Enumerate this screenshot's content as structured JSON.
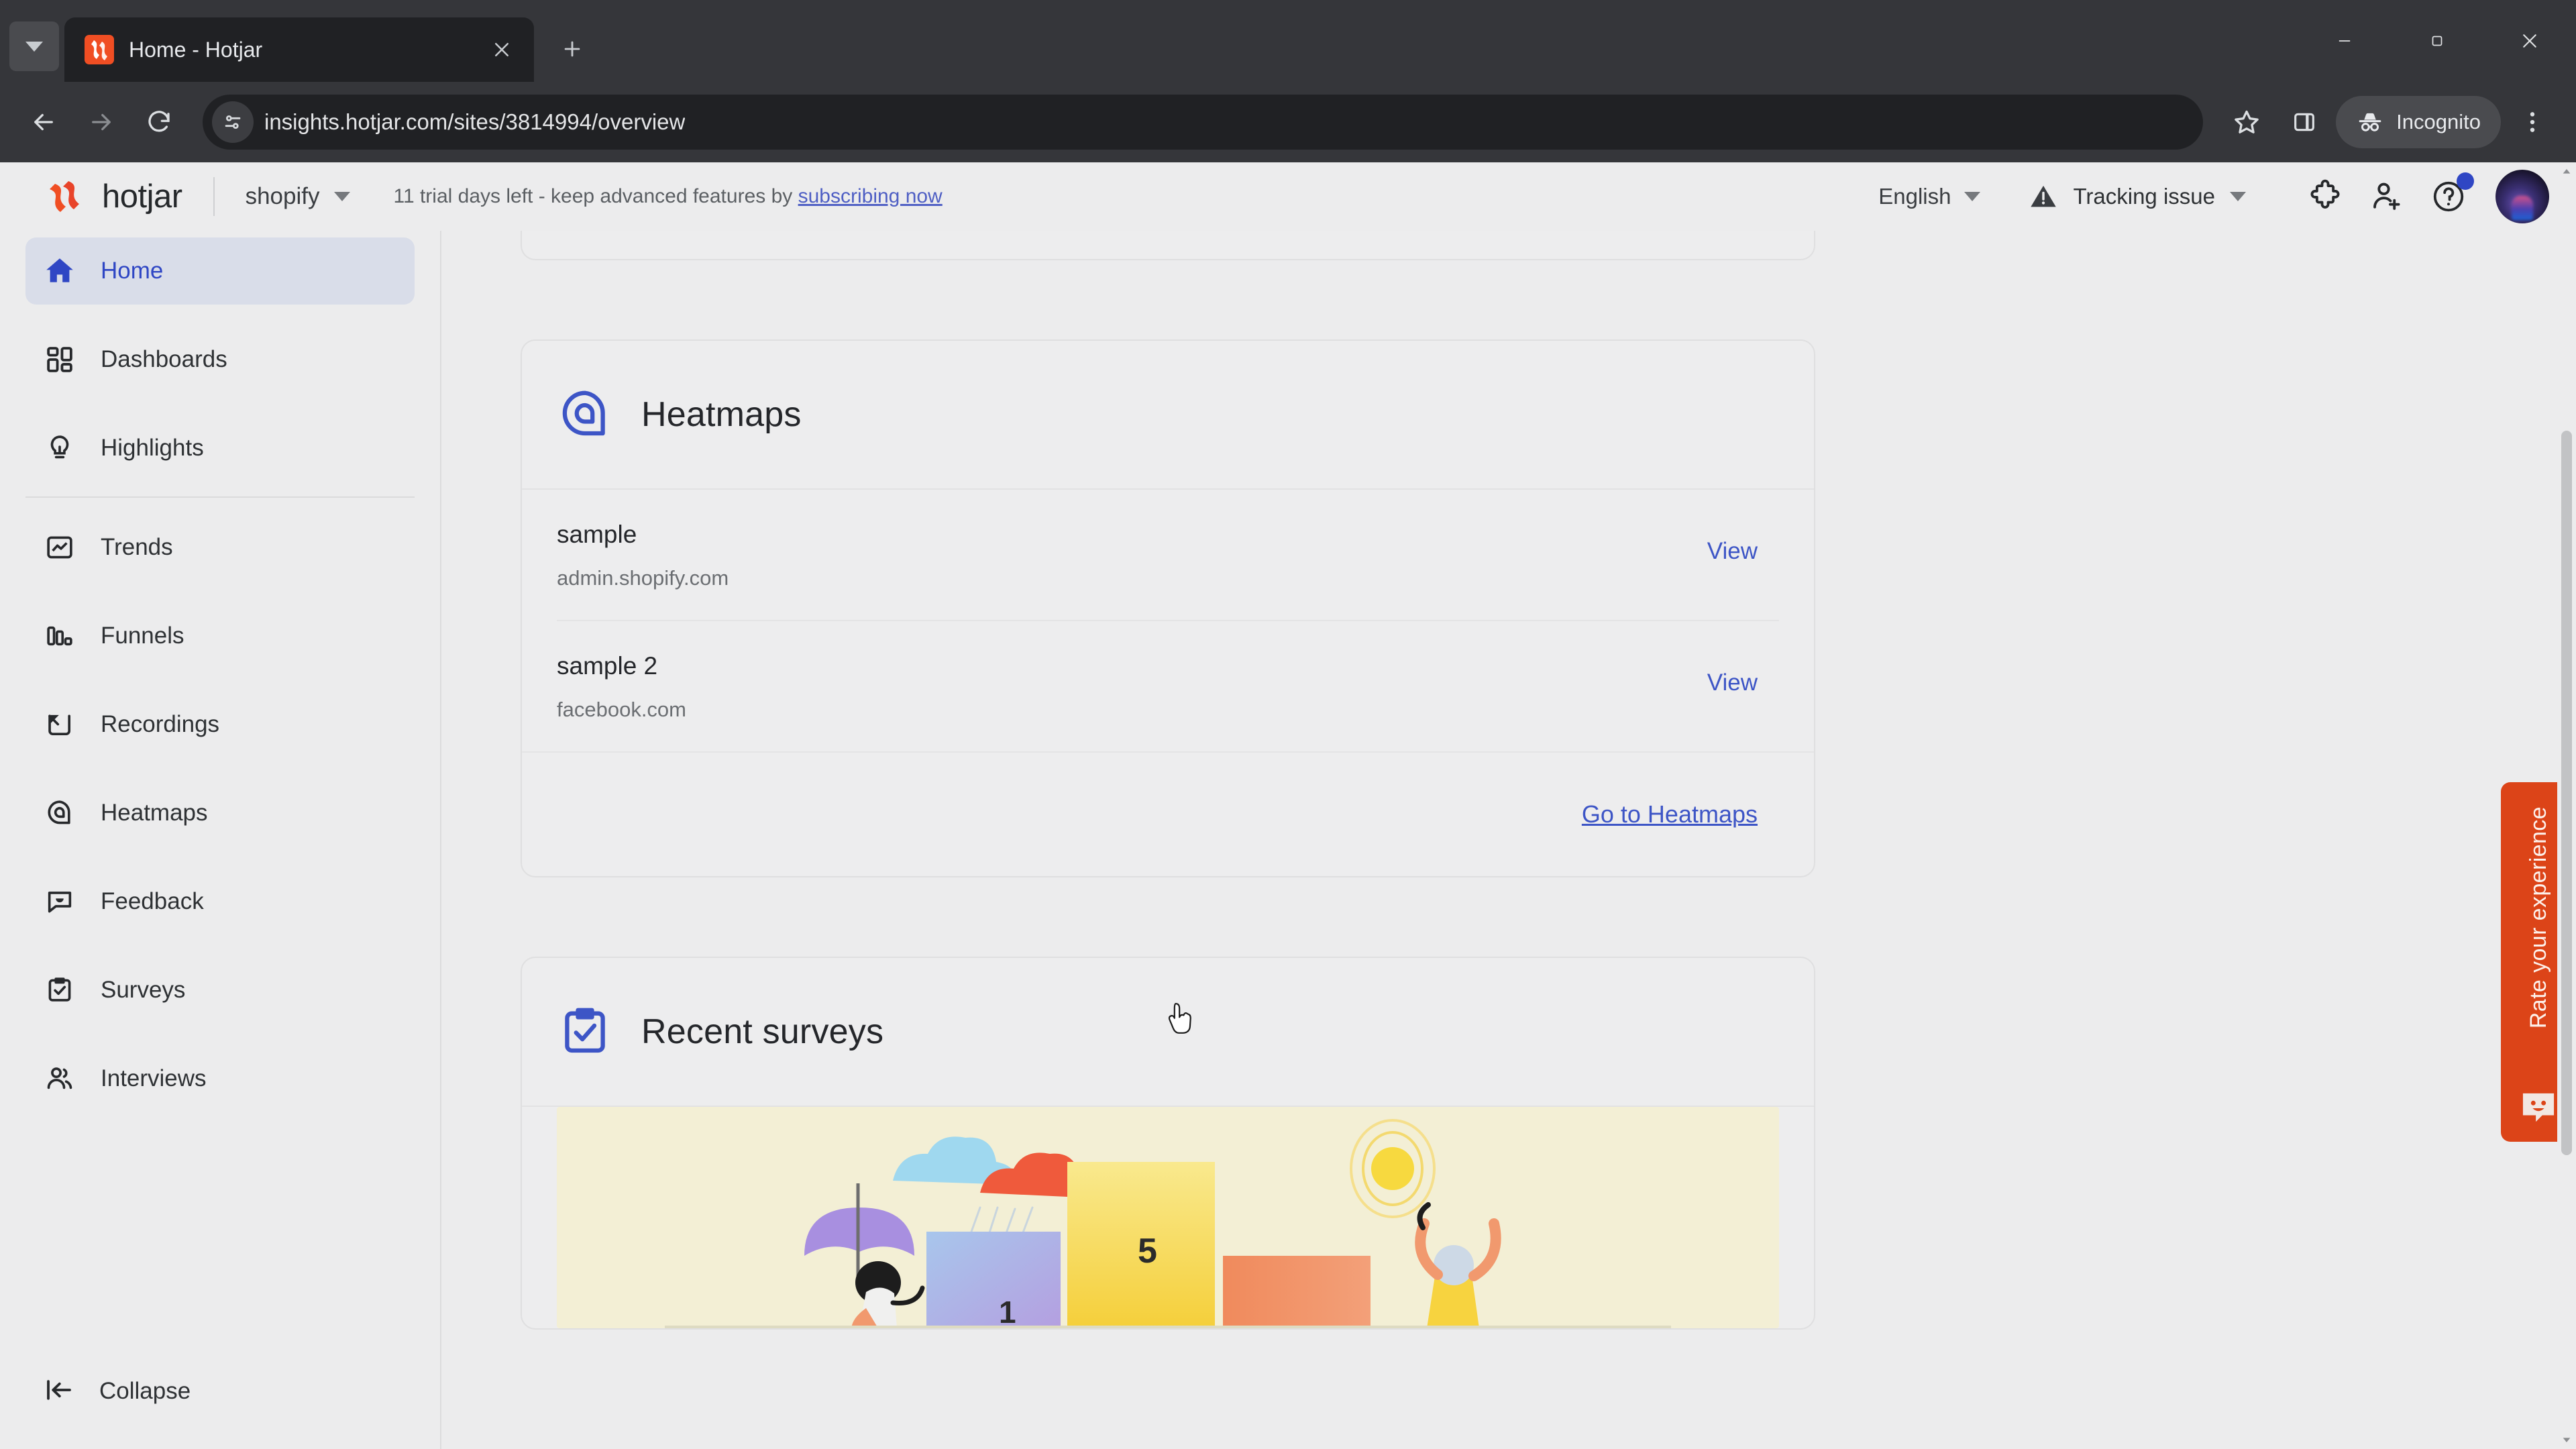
{
  "browser": {
    "tab": {
      "title": "Home - Hotjar",
      "favicon": "hotjar-favicon"
    },
    "new_tab_label": "+",
    "tab_search_icon": "chevron-down-icon",
    "close_icon": "close-icon",
    "nav": {
      "back_icon": "back-arrow-icon",
      "forward_icon": "forward-arrow-icon",
      "reload_icon": "reload-icon"
    },
    "omnibox": {
      "url": "insights.hotjar.com/sites/3814994/overview",
      "site_info_icon": "site-settings-icon",
      "bookmark_icon": "star-icon",
      "side_panel_icon": "side-panel-icon",
      "menu_icon": "three-dot-menu-icon"
    },
    "profile": {
      "label": "Incognito",
      "icon": "incognito-icon"
    },
    "window_controls": {
      "minimize": "minimize-icon",
      "maximize": "maximize-icon",
      "close": "close-icon"
    }
  },
  "app": {
    "brand": {
      "name": "hotjar",
      "logo": "hotjar-logo",
      "color": "#f04e23"
    },
    "site_switcher": {
      "value": "shopify",
      "caret": "chevron-down-icon"
    },
    "trial_banner": {
      "text": "11 trial days left - keep advanced features by ",
      "link_text": "subscribing now"
    },
    "language": {
      "value": "English",
      "caret": "chevron-down-icon"
    },
    "tracking": {
      "label": "Tracking issue",
      "icon": "warning-icon",
      "caret": "chevron-down-icon"
    },
    "header_icons": [
      {
        "name": "integrations-icon",
        "label": "Integrations"
      },
      {
        "name": "invite-user-icon",
        "label": "Invite team member"
      },
      {
        "name": "help-icon",
        "label": "Help",
        "badge": true
      }
    ],
    "avatar": {
      "name": "user-avatar"
    }
  },
  "sidebar": {
    "items": [
      {
        "label": "Home",
        "icon": "home-icon",
        "active": true
      },
      {
        "label": "Dashboards",
        "icon": "dashboards-icon",
        "active": false
      },
      {
        "label": "Highlights",
        "icon": "lightbulb-icon",
        "active": false
      },
      {
        "label": "Trends",
        "icon": "trends-icon",
        "active": false
      },
      {
        "label": "Funnels",
        "icon": "funnels-icon",
        "active": false
      },
      {
        "label": "Recordings",
        "icon": "recordings-icon",
        "active": false
      },
      {
        "label": "Heatmaps",
        "icon": "heatmaps-icon",
        "active": false
      },
      {
        "label": "Feedback",
        "icon": "feedback-icon",
        "active": false
      },
      {
        "label": "Surveys",
        "icon": "surveys-icon",
        "active": false
      },
      {
        "label": "Interviews",
        "icon": "interviews-icon",
        "active": false
      }
    ],
    "collapse": {
      "label": "Collapse",
      "icon": "collapse-icon"
    }
  },
  "main": {
    "heatmaps_card": {
      "title": "Heatmaps",
      "icon": "heatmaps-icon",
      "rows": [
        {
          "name": "sample",
          "url": "admin.shopify.com",
          "action": "View"
        },
        {
          "name": "sample 2",
          "url": "facebook.com",
          "action": "View"
        }
      ],
      "footer_link": "Go to Heatmaps"
    },
    "surveys_card": {
      "title": "Recent surveys",
      "icon": "surveys-clipboard-icon",
      "illustration": {
        "name": "survey-rating-illustration",
        "labels": [
          "1",
          "5"
        ]
      }
    }
  },
  "rate_widget": {
    "text": "Rate your experience",
    "icon": "smiley-feedback-icon",
    "color": "#dc4418"
  }
}
